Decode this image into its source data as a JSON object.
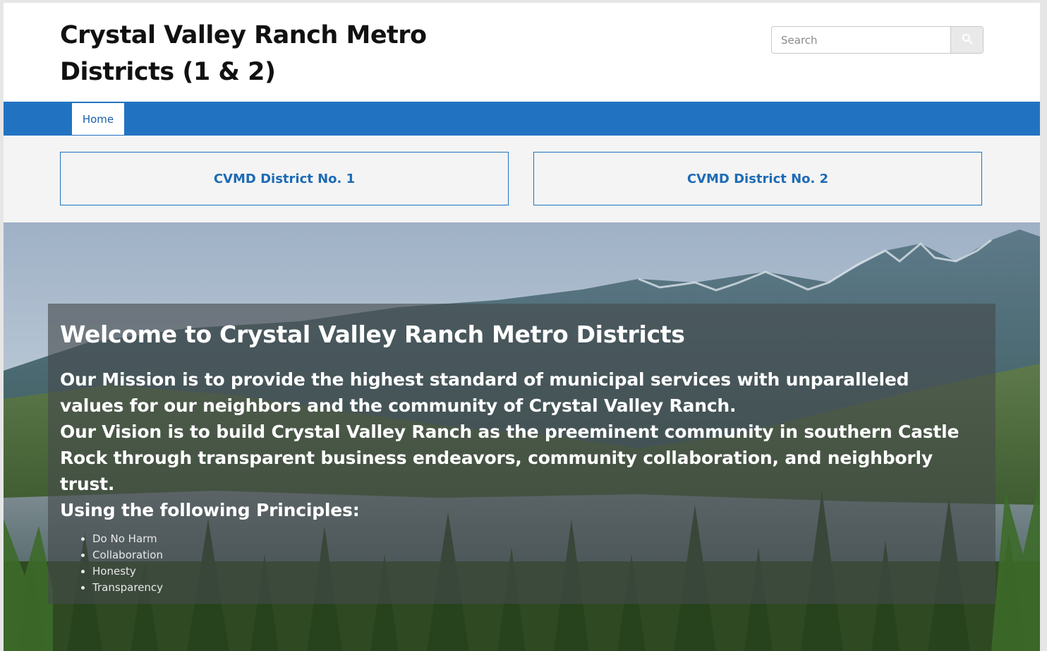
{
  "header": {
    "site_title": "Crystal Valley Ranch Metro Districts (1 & 2)",
    "search": {
      "placeholder": "Search",
      "value": ""
    }
  },
  "nav": {
    "items": [
      {
        "label": "Home"
      }
    ]
  },
  "districts": [
    {
      "label": "CVMD District No. 1"
    },
    {
      "label": "CVMD District No. 2"
    }
  ],
  "hero": {
    "title": "Welcome to Crystal Valley Ranch Metro Districts",
    "mission": "Our Mission is to provide the highest standard of municipal services with unparalleled values for our neighbors and the community of Crystal Valley Ranch.",
    "vision": "Our Vision is to build Crystal Valley Ranch as the preeminent community in southern Castle Rock through transparent business endeavors, community collaboration, and neighborly trust.",
    "principles_heading": "Using the following Principles:",
    "principles": [
      "Do No Harm",
      "Collaboration",
      "Honesty",
      "Transparency"
    ]
  },
  "colors": {
    "nav_bar": "#2173c2",
    "link_blue": "#1d6bb5",
    "overlay": "#464a4c"
  },
  "icons": {
    "search_button": "search-icon"
  }
}
